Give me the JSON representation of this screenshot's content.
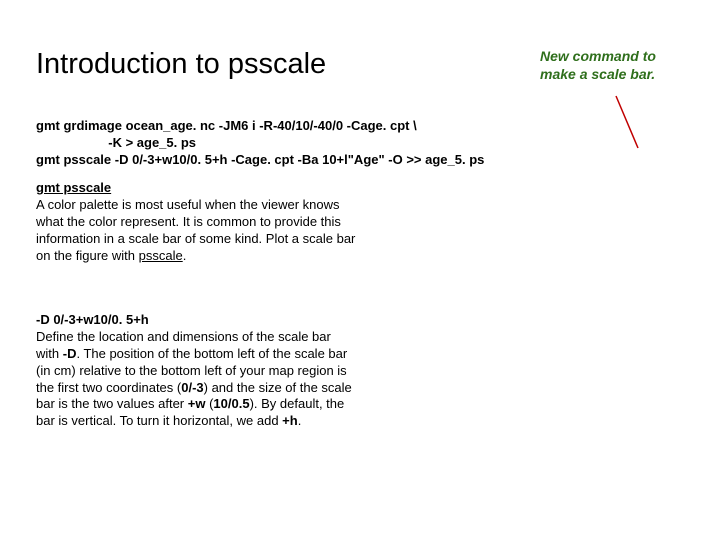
{
  "title": "Introduction to psscale",
  "annotation": {
    "line1": "New command to",
    "line2": "make a scale bar."
  },
  "code": {
    "line1": "gmt grdimage ocean_age. nc -JM6 i -R-40/10/-40/0 -Cage. cpt \\",
    "line2": "                    -K > age_5. ps",
    "line3": "gmt psscale -D 0/-3+w10/0. 5+h -Cage. cpt -Ba 10+l\"Age\" -O >> age_5. ps"
  },
  "para1": {
    "lead": "gmt psscale",
    "text": "A color palette is most useful when the viewer knows what the color represent. It is common to provide this information in a scale bar of some kind. Plot a scale bar on the figure with ",
    "tail_underlined": "psscale",
    "period": "."
  },
  "para2": {
    "lead": "-D 0/-3+w10/0. 5+h",
    "t1": "Define the location and dimensions of the scale bar with ",
    "b1": "-D",
    "t2": ". The position of the bottom left of the scale bar (in cm) relative to the bottom left of your map region is the first two coordinates (",
    "b2": "0/-3",
    "t3": ") and the size of the scale bar is the two values after ",
    "b3": "+w",
    "t4": " (",
    "b4": "10/0.5",
    "t5": "). By default, the bar is vertical. To turn it horizontal, we add ",
    "b5": "+h",
    "t6": "."
  }
}
